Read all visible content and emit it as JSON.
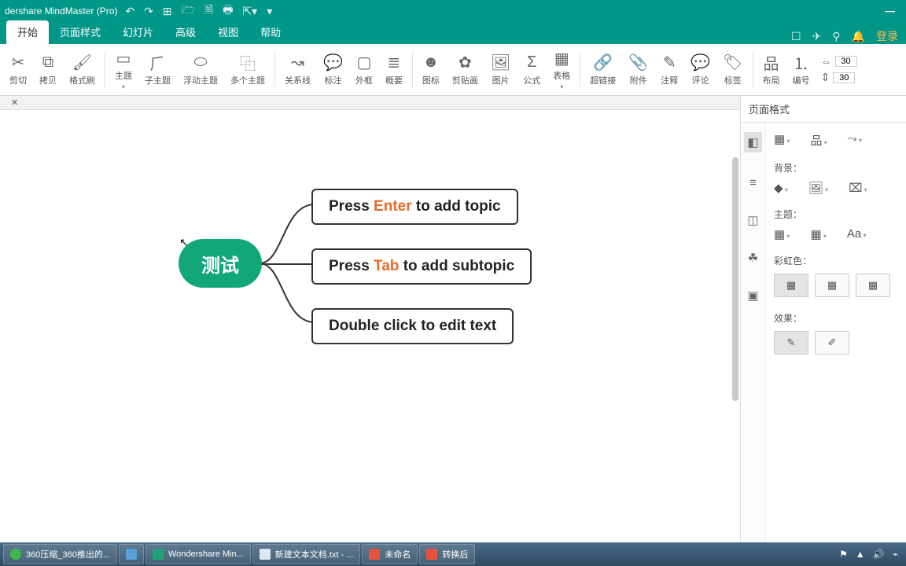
{
  "app": {
    "title": "dershare MindMaster (Pro)"
  },
  "menu": {
    "tabs": [
      "开始",
      "页面样式",
      "幻灯片",
      "高级",
      "视图",
      "帮助"
    ],
    "login": "登录"
  },
  "ribbon": {
    "items": [
      "剪切",
      "拷贝",
      "格式刷",
      "主题",
      "子主题",
      "浮动主题",
      "多个主题",
      "关系线",
      "标注",
      "外框",
      "概要",
      "图标",
      "剪贴画",
      "图片",
      "公式",
      "表格",
      "超链接",
      "附件",
      "注释",
      "评论",
      "标签",
      "布局",
      "编号"
    ],
    "size1": "30",
    "size2": "30"
  },
  "canvas": {
    "central": "测试",
    "topic1_pre": "Press ",
    "topic1_hl": "Enter",
    "topic1_post": " to add topic",
    "topic2_pre": "Press ",
    "topic2_hl": "Tab",
    "topic2_post": " to add subtopic",
    "topic3": "Double click to edit text"
  },
  "rpanel": {
    "title": "页面格式",
    "bg": "背景：",
    "theme": "主题：",
    "rainbow": "彩虹色：",
    "effect": "效果："
  },
  "taskbar": {
    "items": [
      "360压缩_360推出的...",
      "",
      "Wondershare Min...",
      "新建文本文档.txt - ...",
      "未命名",
      "转换后"
    ]
  }
}
